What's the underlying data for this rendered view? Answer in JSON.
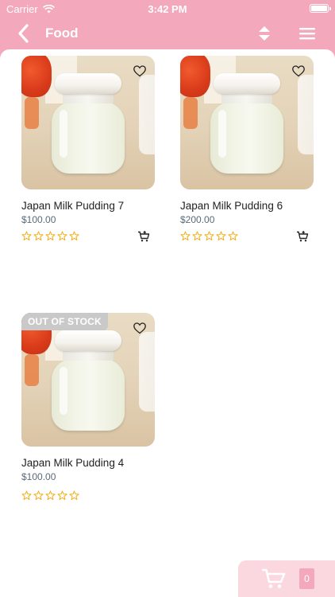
{
  "status_bar": {
    "carrier": "Carrier",
    "time": "3:42 PM"
  },
  "header": {
    "title": "Food"
  },
  "products": [
    {
      "name": "Japan Milk Pudding 7",
      "price": "$100.00",
      "rating": 0,
      "out_of_stock": false
    },
    {
      "name": "Japan Milk Pudding 6",
      "price": "$200.00",
      "rating": 0,
      "out_of_stock": false
    },
    {
      "name": "Japan Milk Pudding 4",
      "price": "$100.00",
      "rating": 0,
      "out_of_stock": true,
      "badge": "OUT OF STOCK"
    }
  ],
  "cart": {
    "count": "0"
  },
  "colors": {
    "brand_pink": "#f3a9bb",
    "star": "#f2b01e",
    "cart_panel": "#fbd7e0"
  }
}
